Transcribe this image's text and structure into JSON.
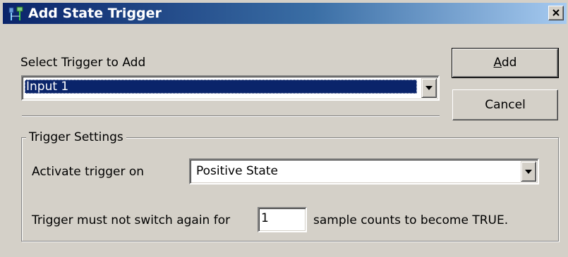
{
  "window": {
    "title": "Add State Trigger",
    "title_icon": "trigger-app-icon",
    "close_icon": "close-icon"
  },
  "select_trigger": {
    "label": "Select Trigger to Add",
    "selected_value": "Input 1"
  },
  "buttons": {
    "add_label_mnemonic": "A",
    "add_label_rest": "dd",
    "cancel_label": "Cancel"
  },
  "trigger_settings": {
    "group_title": "Trigger Settings",
    "activate_label": "Activate trigger on",
    "activate_value": "Positive State",
    "switch_label_before": "Trigger must not switch again for",
    "sample_count_value": "1",
    "switch_label_after": "sample counts to become TRUE."
  },
  "colors": {
    "dialog_background": "#d4d0c8",
    "titlebar_start": "#0a246a",
    "titlebar_end": "#a6caf0",
    "selection": "#0a246a"
  }
}
